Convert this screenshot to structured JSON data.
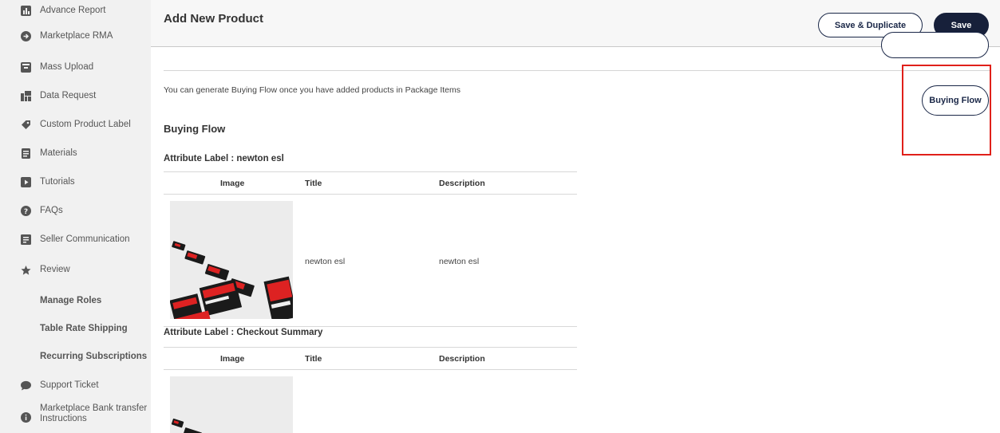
{
  "sidebar": {
    "items": [
      {
        "label": "Advance Report",
        "icon": "bar-chart-icon"
      },
      {
        "label": "Marketplace RMA",
        "icon": "arrow-circle-icon"
      },
      {
        "label": "Mass Upload",
        "icon": "upload-box-icon"
      },
      {
        "label": "Data Request",
        "icon": "data-grid-icon"
      },
      {
        "label": "Custom Product Label",
        "icon": "tag-icon"
      },
      {
        "label": "Materials",
        "icon": "document-icon"
      },
      {
        "label": "Tutorials",
        "icon": "play-icon"
      },
      {
        "label": "FAQs",
        "icon": "question-icon"
      },
      {
        "label": "Seller Communication",
        "icon": "message-icon"
      },
      {
        "label": "Review",
        "icon": "star-icon"
      },
      {
        "label": "Manage Roles"
      },
      {
        "label": "Table Rate Shipping"
      },
      {
        "label": "Recurring Subscriptions"
      },
      {
        "label": "Support Ticket",
        "icon": "chat-bubble-icon"
      },
      {
        "label": "Marketplace Bank transfer Instructions",
        "icon": "info-icon"
      }
    ]
  },
  "header": {
    "title": "Add New Product",
    "save_duplicate_label": "Save & Duplicate",
    "save_label": "Save"
  },
  "main": {
    "info_text": "You can generate Buying Flow once you have added products in Package Items",
    "buying_flow_button": "Buying Flow",
    "section_title": "Buying Flow",
    "attributes": [
      {
        "label": "Attribute Label : newton esl",
        "columns": [
          "Image",
          "Title",
          "Description"
        ],
        "rows": [
          {
            "title": "newton esl",
            "description": "newton esl"
          }
        ]
      },
      {
        "label": "Attribute Label : Checkout Summary",
        "columns": [
          "Image",
          "Title",
          "Description"
        ],
        "rows": []
      }
    ]
  },
  "colors": {
    "navy": "#17203a",
    "highlight": "#e0201a",
    "sidebar_bg": "#f1f1f1"
  }
}
